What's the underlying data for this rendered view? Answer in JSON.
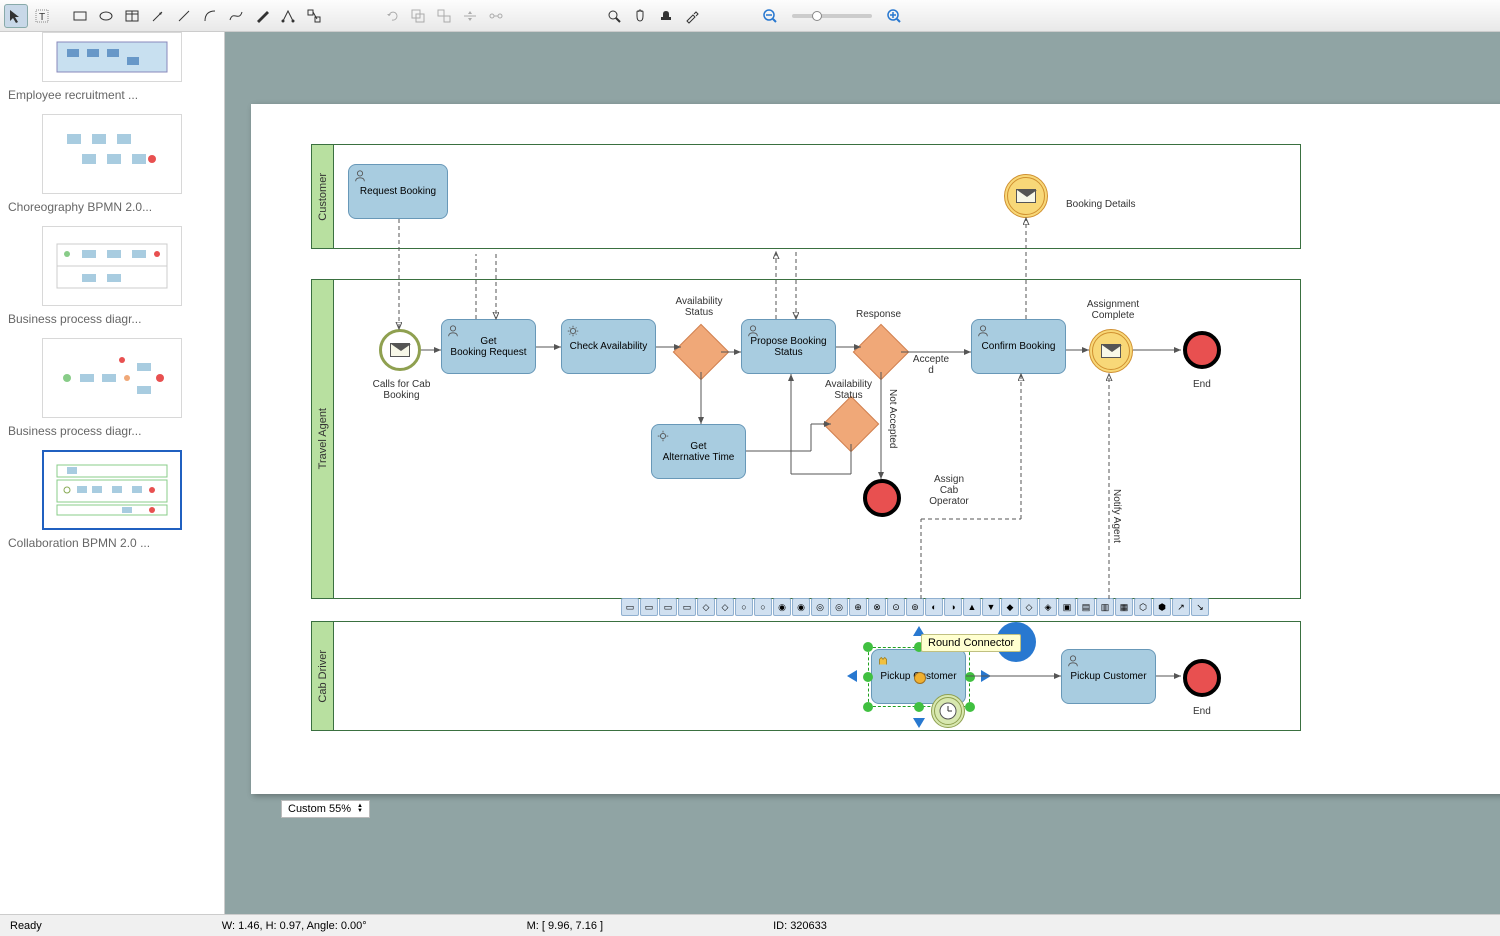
{
  "toolbar": {
    "tools": [
      "select",
      "text",
      "rect",
      "ellipse",
      "table",
      "arrow",
      "line",
      "curve",
      "bezier",
      "pen",
      "node-edit",
      "connector"
    ],
    "edit_tools": [
      "undo",
      "group",
      "ungroup",
      "align",
      "distribute"
    ],
    "view_tools": [
      "zoom",
      "pan",
      "stamp",
      "eyedropper"
    ]
  },
  "sidebar": {
    "items": [
      {
        "label": "Employee recruitment ..."
      },
      {
        "label": "Choreography BPMN 2.0..."
      },
      {
        "label": "Business process diagr..."
      },
      {
        "label": "Business process diagr..."
      },
      {
        "label": "Collaboration BPMN 2.0 ..."
      }
    ]
  },
  "diagram": {
    "pools": [
      {
        "name": "Customer"
      },
      {
        "name": "Travel Agent"
      },
      {
        "name": "Cab Driver"
      }
    ],
    "tasks": {
      "request_booking": "Request Booking",
      "get_booking_request": "Get\nBooking Request",
      "check_availability": "Check Availability",
      "propose_booking": "Propose Booking\nStatus",
      "confirm_booking": "Confirm Booking",
      "get_alternative": "Get\nAlternative Time",
      "pickup_customer_1": "Pickup Customer",
      "pickup_customer_2": "Pickup Customer"
    },
    "labels": {
      "booking_details": "Booking Details",
      "calls_for": "Calls for\nCab Booking",
      "availability_status": "Availability\nStatus",
      "response": "Response",
      "accepted": "Accepte\nd",
      "availability_status_2": "Availability\nStatus",
      "not_accepted": "Not Accepted",
      "assign_cab": "Assign\nCab\nOperator",
      "assignment_complete": "Assignment\nComplete",
      "notify_agent": "Notify Agent",
      "end1": "End",
      "end2": "End"
    },
    "tooltip": "Round Connector"
  },
  "zoom_dropdown": "Custom 55%",
  "status": {
    "ready": "Ready",
    "dims": "W: 1.46,  H: 0.97,  Angle: 0.00°",
    "mouse": "M: [ 9.96, 7.16 ]",
    "id": "ID: 320633"
  }
}
